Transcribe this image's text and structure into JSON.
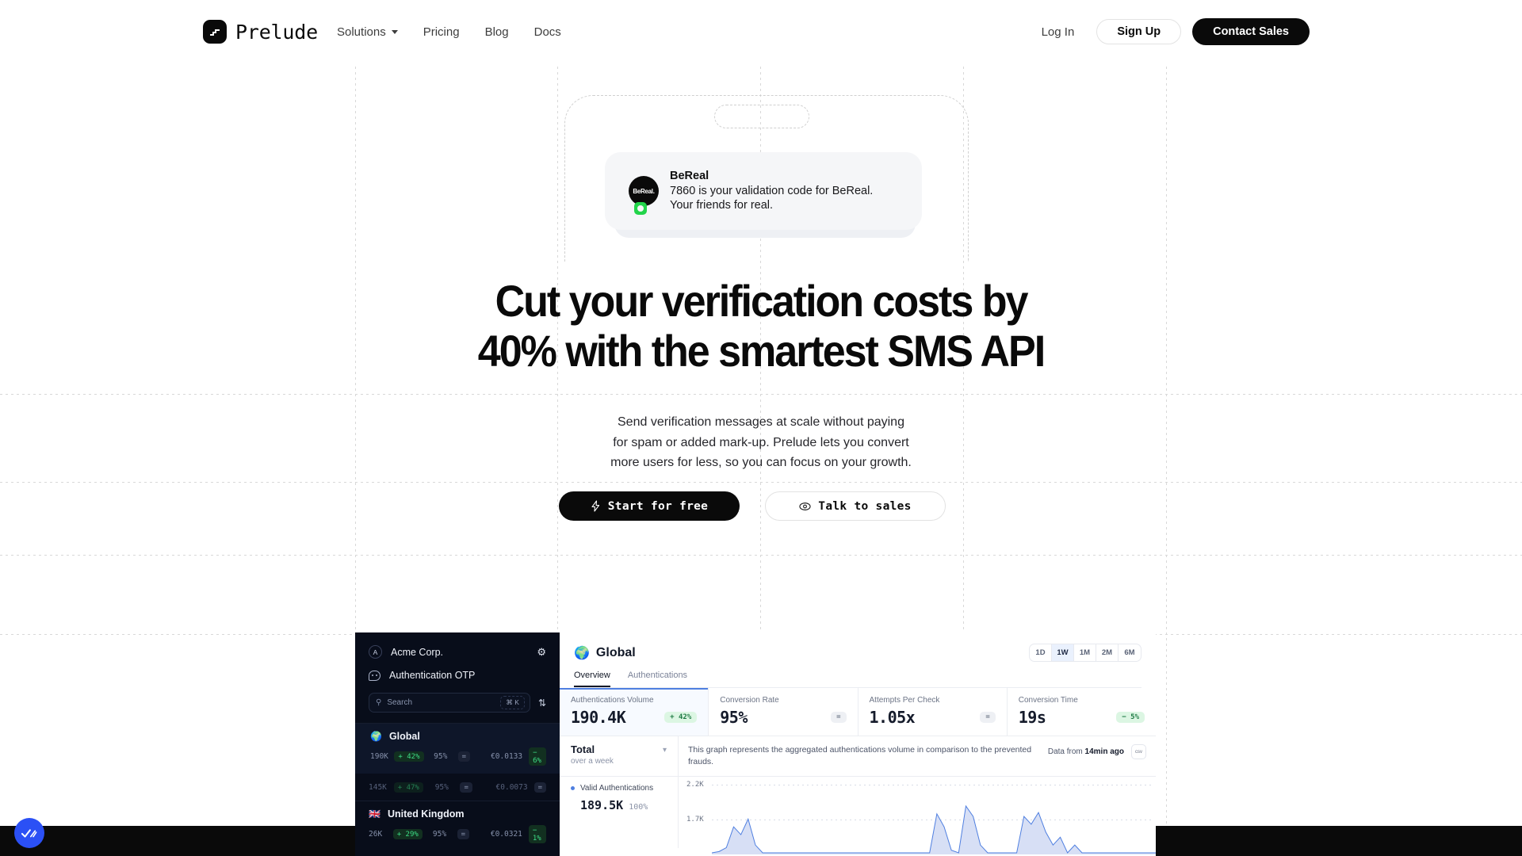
{
  "header": {
    "logo_text": "Prelude",
    "logo_icon": "prelude-logo-icon",
    "nav": [
      {
        "label": "Solutions",
        "has_caret": true
      },
      {
        "label": "Pricing",
        "has_caret": false
      },
      {
        "label": "Blog",
        "has_caret": false
      },
      {
        "label": "Docs",
        "has_caret": false
      }
    ],
    "login_label": "Log In",
    "signup_label": "Sign Up",
    "contact_label": "Contact Sales"
  },
  "sms_card": {
    "avatar_text": "BeReal.",
    "sender": "BeReal",
    "line1": "7860 is your validation code for BeReal.",
    "line2": "Your friends for real."
  },
  "hero": {
    "headline_line1": "Cut your verification costs by",
    "headline_line2": "40% with the smartest SMS API",
    "sub_line1": "Send verification messages at scale without paying",
    "sub_line2": "for spam or added mark-up. Prelude lets you convert",
    "sub_line3": "more users for less, so you can focus on your growth.",
    "cta_primary": "Start for free",
    "cta_primary_icon": "lightning-bolt-icon",
    "cta_secondary": "Talk to sales",
    "cta_secondary_icon": "eye-icon"
  },
  "dashboard": {
    "sidebar": {
      "org_initial": "A",
      "org_name": "Acme Corp.",
      "gear_icon": "gear-icon",
      "project_name": "Authentication OTP",
      "project_icon": "chat-bubble-icon",
      "search_placeholder": "Search",
      "search_icon": "search-icon",
      "search_shortcut": "⌘ K",
      "sort_icon": "sort-arrows-icon",
      "regions": [
        {
          "flag": "🌍",
          "name": "Global",
          "active": true,
          "rows": [
            {
              "volume": "190K",
              "volume_delta": "+ 42%",
              "delta_kind": "up",
              "rate": "95%",
              "rate_delta": "=",
              "rate_kind": "eq",
              "price": "€0.0133",
              "price_delta": "− 6%",
              "price_kind": "dn",
              "dim": false
            },
            {
              "volume": "145K",
              "volume_delta": "+ 47%",
              "delta_kind": "up",
              "rate": "95%",
              "rate_delta": "=",
              "rate_kind": "eq",
              "price": "€0.0073",
              "price_delta": "=",
              "price_kind": "eq",
              "dim": true
            }
          ]
        },
        {
          "flag": "🇬🇧",
          "name": "United Kingdom",
          "active": false,
          "rows": [
            {
              "volume": "26K",
              "volume_delta": "+ 29%",
              "delta_kind": "up",
              "rate": "95%",
              "rate_delta": "=",
              "rate_kind": "eq",
              "price": "€0.0321",
              "price_delta": "− 1%",
              "price_kind": "dn",
              "dim": false
            }
          ]
        }
      ]
    },
    "main": {
      "title": "Global",
      "title_icon": "globe-icon",
      "ranges": [
        "1D",
        "1W",
        "1M",
        "2M",
        "6M"
      ],
      "range_selected": "1W",
      "tabs": [
        {
          "label": "Overview",
          "active": true
        },
        {
          "label": "Authentications",
          "active": false
        }
      ],
      "kpis": [
        {
          "label": "Authentications Volume",
          "value": "190.4K",
          "chip": "+ 42%",
          "chip_kind": "g",
          "selected": true
        },
        {
          "label": "Conversion Rate",
          "value": "95%",
          "chip": "=",
          "chip_kind": "n",
          "selected": false
        },
        {
          "label": "Attempts Per Check",
          "value": "1.05x",
          "chip": "=",
          "chip_kind": "n",
          "selected": false
        },
        {
          "label": "Conversion Time",
          "value": "19s",
          "chip": "− 5%",
          "chip_kind": "g",
          "selected": false
        }
      ],
      "graph": {
        "group_label": "Total",
        "group_sub": "over a week",
        "chevron_icon": "chevron-down-icon",
        "description": "This graph represents the aggregated authentications volume in comparison to the prevented frauds.",
        "data_from_prefix": "Data from ",
        "data_from_value": "14min ago",
        "csv_label": "csv",
        "csv_icon": "download-csv-icon",
        "legend_label": "Valid Authentications",
        "legend_value": "189.5K",
        "legend_pct": "100%"
      }
    }
  },
  "chart_data": {
    "type": "area",
    "title": "Authentications Volume",
    "series": [
      {
        "name": "Valid Authentications",
        "color": "#4f7fe0",
        "values": [
          1700,
          1710,
          1740,
          1900,
          1840,
          1960,
          1760,
          1700,
          1700,
          1700,
          1700,
          1700,
          1700,
          1700,
          1700,
          1700,
          1700,
          1700,
          1700,
          1700,
          1700,
          1700,
          1700,
          1700,
          1700,
          1700,
          1700,
          1700,
          1700,
          1700,
          1700,
          2000,
          1900,
          1720,
          1700,
          2060,
          1980,
          1760,
          1700,
          1700,
          1700,
          1700,
          1700,
          1980,
          1920,
          2010,
          1860,
          1760,
          1820,
          1700,
          1760,
          1700,
          1700,
          1700,
          1700,
          1700,
          1700,
          1700,
          1700,
          1700,
          1700,
          1700,
          1700,
          1700,
          1700,
          1700,
          1720,
          1700,
          1700,
          1840,
          1930,
          2130,
          1980,
          1880,
          1820,
          1910,
          1790,
          1700,
          1700,
          1720,
          1700,
          1700,
          1790,
          1700
        ]
      }
    ],
    "ylabel": "",
    "xlabel": "",
    "yticks": [
      "2.2K",
      "1.7K"
    ],
    "ylim": [
      1700,
      2200
    ],
    "grid": true,
    "legend_position": "left"
  },
  "chat_widget": {
    "icon": "double-check-icon",
    "color": "#2b50f5"
  }
}
